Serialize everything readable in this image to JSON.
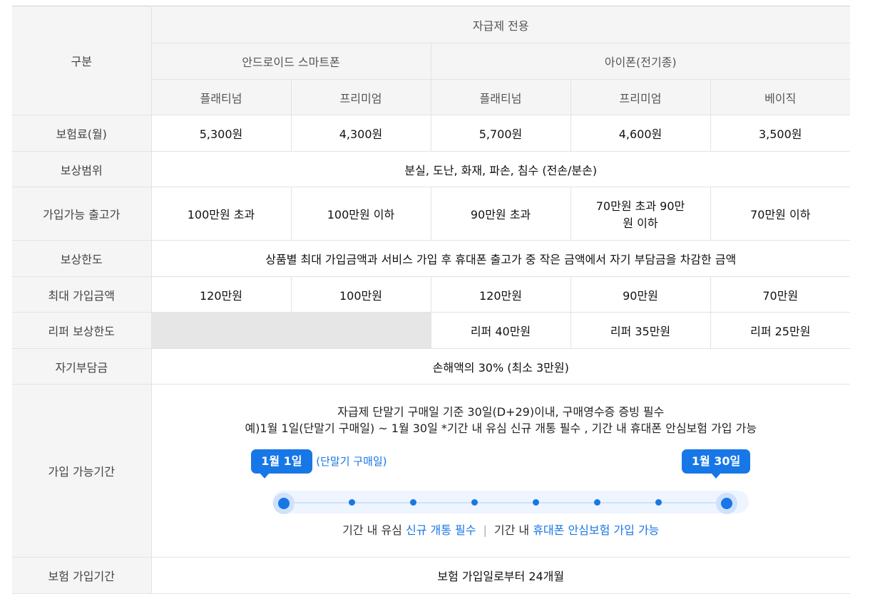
{
  "header": {
    "category": "구분",
    "self_only": "자급제 전용",
    "android": "안드로이드 스마트폰",
    "iphone": "아이폰(전기종)",
    "plans": [
      "플래티넘",
      "프리미엄",
      "플래티넘",
      "프리미엄",
      "베이직"
    ]
  },
  "rows": {
    "premium": {
      "label": "보험료(월)",
      "values": [
        "5,300원",
        "4,300원",
        "5,700원",
        "4,600원",
        "3,500원"
      ]
    },
    "coverage": {
      "label": "보상범위",
      "value": "분실, 도난, 화재, 파손, 침수 (전손/분손)"
    },
    "price": {
      "label": "가입가능 출고가",
      "values": [
        "100만원 초과",
        "100만원 이하",
        "90만원 초과",
        "70만원 초과 90만원 이하",
        "70만원 이하"
      ]
    },
    "limit": {
      "label": "보상한도",
      "value": "상품별 최대 가입금액과 서비스 가입 후 휴대폰 출고가 중 작은 금액에서 자기 부담금을 차감한 금액"
    },
    "max_amount": {
      "label": "최대 가입금액",
      "values": [
        "120만원",
        "100만원",
        "120만원",
        "90만원",
        "70만원"
      ]
    },
    "refurb": {
      "label": "리퍼 보상한도",
      "values": [
        "리퍼 40만원",
        "리퍼 35만원",
        "리퍼 25만원"
      ]
    },
    "deductible": {
      "label": "자기부담금",
      "value": "손해액의 30% (최소 3만원)"
    },
    "period": {
      "label": "가입 가능기간",
      "line1": "자급제 단말기 구매일 기준 30일(D+29)이내, 구매영수증 증빙 필수",
      "line2": "예)1월 1일(단말기 구매일) ~ 1월 30일 *기간 내 유심 신규 개통 필수 , 기간 내 휴대폰 안심보험 가입 가능",
      "badge_start": "1월 1일",
      "badge_note": "(단말기 구매일)",
      "badge_end": "1월 30일",
      "caption_a": "기간 내 유심 ",
      "caption_a_hl": "신규 개통 필수",
      "caption_sep": "|",
      "caption_b": "기간 내 ",
      "caption_b_hl": "휴대폰 안심보험 가입 가능"
    },
    "term": {
      "label": "보험 가입기간",
      "value": "보험 가입일로부터 24개월"
    }
  },
  "colors": {
    "accent": "#1877e6",
    "header_bg": "#f5f5f5",
    "disabled_bg": "#e6e6e6"
  }
}
